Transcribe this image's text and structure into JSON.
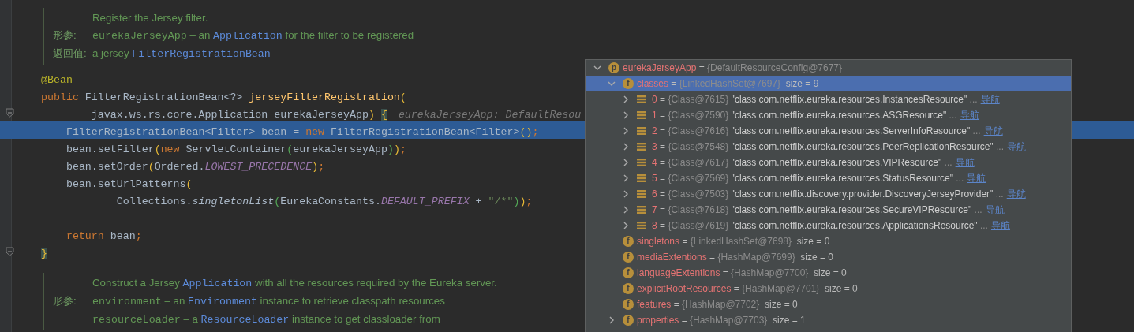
{
  "editor": {
    "blocks": [
      {
        "kind": "doc",
        "lines": [
          {
            "tokens": [
              {
                "kind": "text",
                "text": "Register the Jersey filter."
              }
            ]
          },
          {
            "label": "形参:",
            "tokens": [
              {
                "kind": "code",
                "text": "eurekaJerseyApp"
              },
              {
                "kind": "text",
                "text": " – an "
              },
              {
                "kind": "ref",
                "text": "Application"
              },
              {
                "kind": "text",
                "text": " for the filter to be registered"
              }
            ]
          },
          {
            "label": "返回值:",
            "tokens": [
              {
                "kind": "text",
                "text": "a jersey "
              },
              {
                "kind": "ref",
                "text": "FilterRegistrationBean"
              }
            ]
          }
        ]
      },
      {
        "kind": "code",
        "lines": [
          {
            "kind": "code",
            "selected": false,
            "fold_marker": false,
            "tokens": [
              {
                "kind": "annot",
                "text": "@Bean"
              }
            ]
          },
          {
            "kind": "code",
            "selected": false,
            "fold_marker": false,
            "tokens": [
              {
                "kind": "kw",
                "text": "public "
              },
              {
                "kind": "plain",
                "text": "FilterRegistrationBean<?> "
              },
              {
                "kind": "decl",
                "text": "jerseyFilterRegistration"
              },
              {
                "kind": "bracket",
                "text": "("
              }
            ]
          },
          {
            "kind": "code",
            "selected": false,
            "fold_marker": true,
            "tokens": [
              {
                "kind": "plain",
                "text": "        javax.ws.rs.core.Application eurekaJerseyApp"
              },
              {
                "kind": "bracket",
                "text": ") "
              },
              {
                "kind": "brace",
                "text": "{"
              },
              {
                "kind": "hint",
                "text": "eurekaJerseyApp: DefaultResou"
              }
            ]
          },
          {
            "kind": "code",
            "selected": true,
            "fold_marker": false,
            "tokens": [
              {
                "kind": "plain",
                "text": "    FilterRegistrationBean<Filter> bean = "
              },
              {
                "kind": "kw",
                "text": "new "
              },
              {
                "kind": "plain",
                "text": "FilterRegistrationBean<Filter>"
              },
              {
                "kind": "bracket",
                "text": "()"
              },
              {
                "kind": "kw",
                "text": ";"
              }
            ]
          },
          {
            "kind": "code",
            "selected": false,
            "fold_marker": false,
            "tokens": [
              {
                "kind": "plain",
                "text": "    bean.setFilter"
              },
              {
                "kind": "bracket",
                "text": "("
              },
              {
                "kind": "kw",
                "text": "new "
              },
              {
                "kind": "plain",
                "text": "ServletContainer"
              },
              {
                "kind": "bracket2",
                "text": "("
              },
              {
                "kind": "plain",
                "text": "eurekaJerseyApp"
              },
              {
                "kind": "bracket2",
                "text": ")"
              },
              {
                "kind": "bracket",
                "text": ")"
              },
              {
                "kind": "kw",
                "text": ";"
              }
            ]
          },
          {
            "kind": "code",
            "selected": false,
            "fold_marker": false,
            "tokens": [
              {
                "kind": "plain",
                "text": "    bean.setOrder"
              },
              {
                "kind": "bracket",
                "text": "("
              },
              {
                "kind": "plain",
                "text": "Ordered."
              },
              {
                "kind": "const",
                "text": "LOWEST_PRECEDENCE"
              },
              {
                "kind": "bracket",
                "text": ")"
              },
              {
                "kind": "kw",
                "text": ";"
              }
            ]
          },
          {
            "kind": "code",
            "selected": false,
            "fold_marker": false,
            "tokens": [
              {
                "kind": "plain",
                "text": "    bean.setUrlPatterns"
              },
              {
                "kind": "bracket",
                "text": "("
              }
            ]
          },
          {
            "kind": "code",
            "selected": false,
            "fold_marker": false,
            "tokens": [
              {
                "kind": "plain",
                "text": "            Collections."
              },
              {
                "kind": "static",
                "text": "singletonList"
              },
              {
                "kind": "bracket2",
                "text": "("
              },
              {
                "kind": "plain",
                "text": "EurekaConstants."
              },
              {
                "kind": "const",
                "text": "DEFAULT_PREFIX"
              },
              {
                "kind": "plain",
                "text": " + "
              },
              {
                "kind": "str",
                "text": "\"/*\""
              },
              {
                "kind": "bracket2",
                "text": ")"
              },
              {
                "kind": "bracket",
                "text": ")"
              },
              {
                "kind": "kw",
                "text": ";"
              }
            ]
          },
          {
            "kind": "blank"
          },
          {
            "kind": "code",
            "selected": false,
            "fold_marker": false,
            "tokens": [
              {
                "kind": "kw",
                "text": "    return "
              },
              {
                "kind": "plain",
                "text": "bean"
              },
              {
                "kind": "kw",
                "text": ";"
              }
            ]
          },
          {
            "kind": "code",
            "selected": false,
            "fold_marker": true,
            "tokens": [
              {
                "kind": "brace",
                "text": "}"
              }
            ]
          }
        ]
      },
      {
        "kind": "doc",
        "lines": [
          {
            "tokens": [
              {
                "kind": "text",
                "text": "Construct a Jersey "
              },
              {
                "kind": "ref",
                "text": "Application"
              },
              {
                "kind": "text",
                "text": " with all the resources required by the Eureka server."
              }
            ]
          },
          {
            "label": "形参:",
            "tokens": [
              {
                "kind": "code",
                "text": "environment"
              },
              {
                "kind": "text",
                "text": " – an "
              },
              {
                "kind": "ref",
                "text": "Environment"
              },
              {
                "kind": "text",
                "text": " instance to retrieve classpath resources"
              }
            ]
          },
          {
            "tokens": [
              {
                "kind": "code",
                "text": "resourceLoader"
              },
              {
                "kind": "text",
                "text": " – a "
              },
              {
                "kind": "ref",
                "text": "ResourceLoader"
              },
              {
                "kind": "text",
                "text": " instance to get classloader from"
              }
            ]
          }
        ]
      }
    ]
  },
  "debug_popup": {
    "items": [
      {
        "kind": "parameter",
        "icon_letter": "p",
        "name": "eurekaJerseyApp",
        "operator": "=",
        "value": "{DefaultResourceConfig@7677}",
        "expanded": true,
        "selected": false,
        "children": [
          {
            "kind": "field",
            "icon_letter": "f",
            "name": "classes",
            "operator": "=",
            "value": "{LinkedHashSet@7697}",
            "size": "size = 9",
            "expanded": true,
            "selected": true,
            "children": [
              {
                "kind": "element",
                "name": "0",
                "operator": "=",
                "value": "{Class@7615}",
                "string": "\"class com.netflix.eureka.resources.InstancesResource\"",
                "ellipsis": "...",
                "link": "导航",
                "expanded": false,
                "selected": false
              },
              {
                "kind": "element",
                "name": "1",
                "operator": "=",
                "value": "{Class@7590}",
                "string": "\"class com.netflix.eureka.resources.ASGResource\"",
                "ellipsis": "...",
                "link": "导航",
                "expanded": false,
                "selected": false
              },
              {
                "kind": "element",
                "name": "2",
                "operator": "=",
                "value": "{Class@7616}",
                "string": "\"class com.netflix.eureka.resources.ServerInfoResource\"",
                "ellipsis": "...",
                "link": "导航",
                "expanded": false,
                "selected": false
              },
              {
                "kind": "element",
                "name": "3",
                "operator": "=",
                "value": "{Class@7548}",
                "string": "\"class com.netflix.eureka.resources.PeerReplicationResource\"",
                "ellipsis": "...",
                "link": "导航",
                "expanded": false,
                "selected": false
              },
              {
                "kind": "element",
                "name": "4",
                "operator": "=",
                "value": "{Class@7617}",
                "string": "\"class com.netflix.eureka.resources.VIPResource\"",
                "ellipsis": "...",
                "link": "导航",
                "expanded": false,
                "selected": false
              },
              {
                "kind": "element",
                "name": "5",
                "operator": "=",
                "value": "{Class@7569}",
                "string": "\"class com.netflix.eureka.resources.StatusResource\"",
                "ellipsis": "...",
                "link": "导航",
                "expanded": false,
                "selected": false
              },
              {
                "kind": "element",
                "name": "6",
                "operator": "=",
                "value": "{Class@7503}",
                "string": "\"class com.netflix.discovery.provider.DiscoveryJerseyProvider\"",
                "ellipsis": "...",
                "link": "导航",
                "expanded": false,
                "selected": false
              },
              {
                "kind": "element",
                "name": "7",
                "operator": "=",
                "value": "{Class@7618}",
                "string": "\"class com.netflix.eureka.resources.SecureVIPResource\"",
                "ellipsis": "...",
                "link": "导航",
                "expanded": false,
                "selected": false
              },
              {
                "kind": "element",
                "name": "8",
                "operator": "=",
                "value": "{Class@7619}",
                "string": "\"class com.netflix.eureka.resources.ApplicationsResource\"",
                "ellipsis": "...",
                "link": "导航",
                "expanded": false,
                "selected": false
              }
            ]
          },
          {
            "kind": "field",
            "icon_letter": "f",
            "name": "singletons",
            "operator": "=",
            "value": "{LinkedHashSet@7698}",
            "size": "size = 0",
            "selected": false
          },
          {
            "kind": "field",
            "icon_letter": "f",
            "name": "mediaExtentions",
            "operator": "=",
            "value": "{HashMap@7699}",
            "size": "size = 0",
            "selected": false
          },
          {
            "kind": "field",
            "icon_letter": "f",
            "name": "languageExtentions",
            "operator": "=",
            "value": "{HashMap@7700}",
            "size": "size = 0",
            "selected": false
          },
          {
            "kind": "field",
            "icon_letter": "f",
            "name": "explicitRootResources",
            "operator": "=",
            "value": "{HashMap@7701}",
            "size": "size = 0",
            "selected": false
          },
          {
            "kind": "field",
            "icon_letter": "f",
            "name": "features",
            "operator": "=",
            "value": "{HashMap@7702}",
            "size": "size = 0",
            "selected": false
          },
          {
            "kind": "field",
            "icon_letter": "f",
            "name": "properties",
            "operator": "=",
            "value": "{HashMap@7703}",
            "size": "size = 1",
            "expanded": false,
            "selected": false
          }
        ]
      }
    ]
  }
}
